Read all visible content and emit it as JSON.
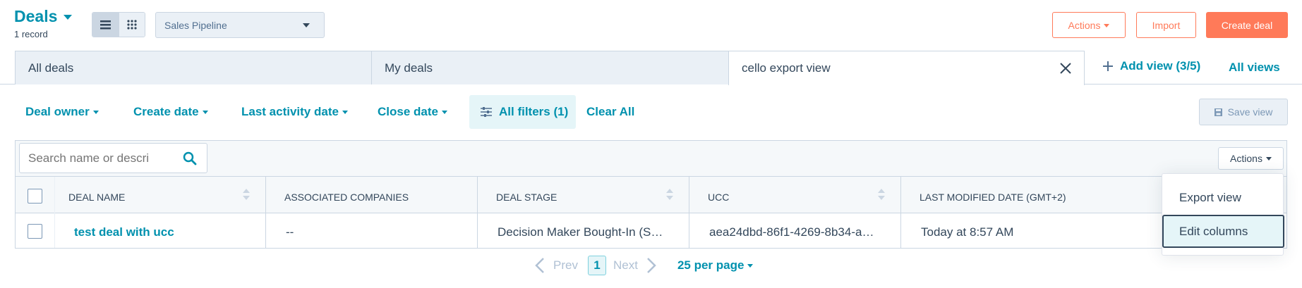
{
  "header": {
    "title": "Deals",
    "record_count": "1 record",
    "pipeline_select": "Sales Pipeline",
    "actions_label": "Actions",
    "import_label": "Import",
    "create_label": "Create deal"
  },
  "views": {
    "tabs": [
      {
        "label": "All deals"
      },
      {
        "label": "My deals"
      },
      {
        "label": "cello export view"
      }
    ],
    "add_view": "Add view (3/5)",
    "all_views": "All views"
  },
  "filters": {
    "items": [
      "Deal owner",
      "Create date",
      "Last activity date",
      "Close date"
    ],
    "all_filters": "All filters (1)",
    "clear_all": "Clear All",
    "save_view": "Save view"
  },
  "search": {
    "placeholder": "Search name or descri"
  },
  "table_actions": "Actions",
  "table": {
    "columns": [
      "DEAL NAME",
      "ASSOCIATED COMPANIES",
      "DEAL STAGE",
      "UCC",
      "LAST MODIFIED DATE (GMT+2)"
    ],
    "rows": [
      {
        "deal_name": "test deal with ucc",
        "companies": "--",
        "stage": "Decision Maker Bought-In (S…",
        "ucc": "aea24dbd-86f1-4269-8b34-a…",
        "modified": "Today at 8:57 AM"
      }
    ]
  },
  "dropdown": {
    "items": [
      "Export view",
      "Edit columns"
    ]
  },
  "pagination": {
    "prev": "Prev",
    "page": "1",
    "next": "Next",
    "per_page": "25 per page"
  },
  "colors": {
    "accent": "#0091ae",
    "orange": "#ff7a59",
    "border": "#cbd6e2"
  }
}
